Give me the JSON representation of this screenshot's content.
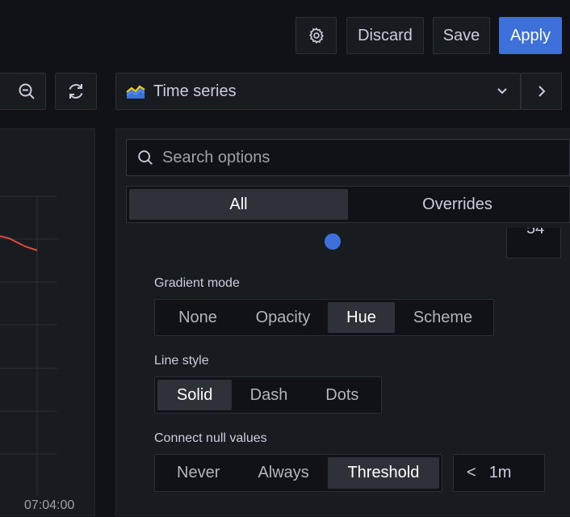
{
  "toolbar": {
    "discard_label": "Discard",
    "save_label": "Save",
    "apply_label": "Apply"
  },
  "viz": {
    "name": "Time series"
  },
  "options": {
    "search_placeholder": "Search options",
    "tabs": [
      {
        "label": "All",
        "active": true
      },
      {
        "label": "Overrides",
        "active": false
      }
    ],
    "partial_value": "54",
    "gradient_mode": {
      "label": "Gradient mode",
      "options": [
        "None",
        "Opacity",
        "Hue",
        "Scheme"
      ],
      "selected": "Hue"
    },
    "line_style": {
      "label": "Line style",
      "options": [
        "Solid",
        "Dash",
        "Dots"
      ],
      "selected": "Solid"
    },
    "connect_null": {
      "label": "Connect null values",
      "options": [
        "Never",
        "Always",
        "Threshold"
      ],
      "selected": "Threshold",
      "threshold_operator": "<",
      "threshold_value": "1m"
    }
  },
  "graph": {
    "x_tick": "07:04:00"
  },
  "icons": {
    "settings": "gear-icon",
    "zoom_out": "zoom-out-icon",
    "refresh": "refresh-icon",
    "viz": "time-series-icon",
    "dropdown": "chevron-down-icon",
    "next": "chevron-right-icon",
    "search": "search-icon"
  },
  "colors": {
    "primary": "#3d71d9",
    "series_line": "#e0493e",
    "background": "#111217",
    "panel": "#181b1f"
  }
}
